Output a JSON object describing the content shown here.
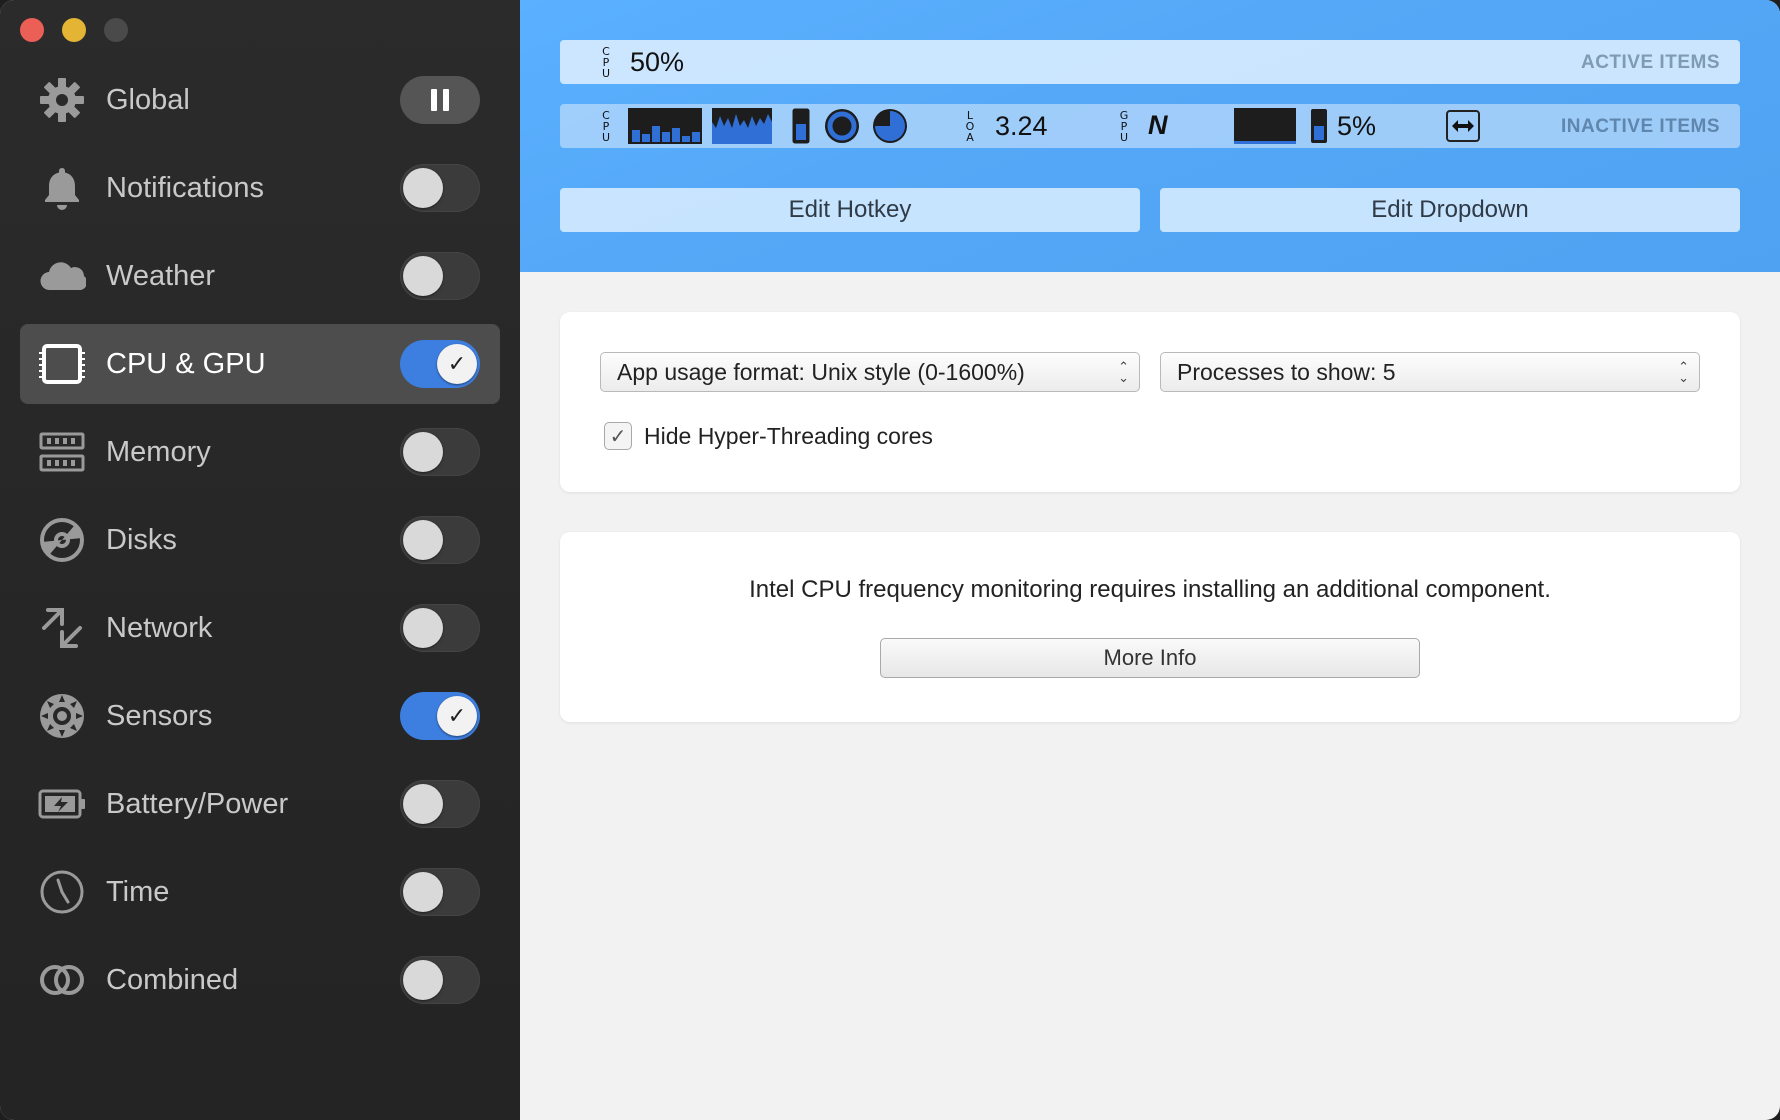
{
  "sidebar": {
    "items": [
      {
        "label": "Global",
        "icon": "gear-icon",
        "control": "pause"
      },
      {
        "label": "Notifications",
        "icon": "bell-icon",
        "control": "off"
      },
      {
        "label": "Weather",
        "icon": "cloud-icon",
        "control": "off"
      },
      {
        "label": "CPU & GPU",
        "icon": "chip-icon",
        "control": "on",
        "selected": true
      },
      {
        "label": "Memory",
        "icon": "memory-icon",
        "control": "off"
      },
      {
        "label": "Disks",
        "icon": "disk-icon",
        "control": "off"
      },
      {
        "label": "Network",
        "icon": "network-arrows-icon",
        "control": "off"
      },
      {
        "label": "Sensors",
        "icon": "fan-icon",
        "control": "on"
      },
      {
        "label": "Battery/Power",
        "icon": "battery-icon",
        "control": "off"
      },
      {
        "label": "Time",
        "icon": "clock-icon",
        "control": "off"
      },
      {
        "label": "Combined",
        "icon": "rings-icon",
        "control": "off"
      }
    ]
  },
  "header": {
    "active_bar": {
      "tag": "ACTIVE ITEMS",
      "cpu_label": [
        "C",
        "P",
        "U"
      ],
      "cpu_value": "50%"
    },
    "inactive_bar": {
      "tag": "INACTIVE ITEMS",
      "cpu_label": [
        "C",
        "P",
        "U"
      ],
      "load_label": [
        "L",
        "O",
        "A"
      ],
      "load_value": "3.24",
      "gpu_label": [
        "G",
        "P",
        "U"
      ],
      "gpu_mark": "N",
      "gpu_value": "5%"
    },
    "edit_hotkey": "Edit Hotkey",
    "edit_dropdown": "Edit Dropdown"
  },
  "settings": {
    "app_usage_select": "App usage format: Unix style (0-1600%)",
    "processes_select": "Processes to show: 5",
    "hide_ht_label": "Hide Hyper-Threading cores",
    "hide_ht_checked": true
  },
  "info": {
    "message": "Intel CPU frequency monitoring requires installing an additional component.",
    "more_info": "More Info"
  },
  "colors": {
    "accent": "#3d7fe0",
    "header_blue": "#55a8f7",
    "sidebar_bg": "#282828",
    "selected_bg": "#4d4d4d",
    "graph_blue": "#2f6fd6"
  }
}
